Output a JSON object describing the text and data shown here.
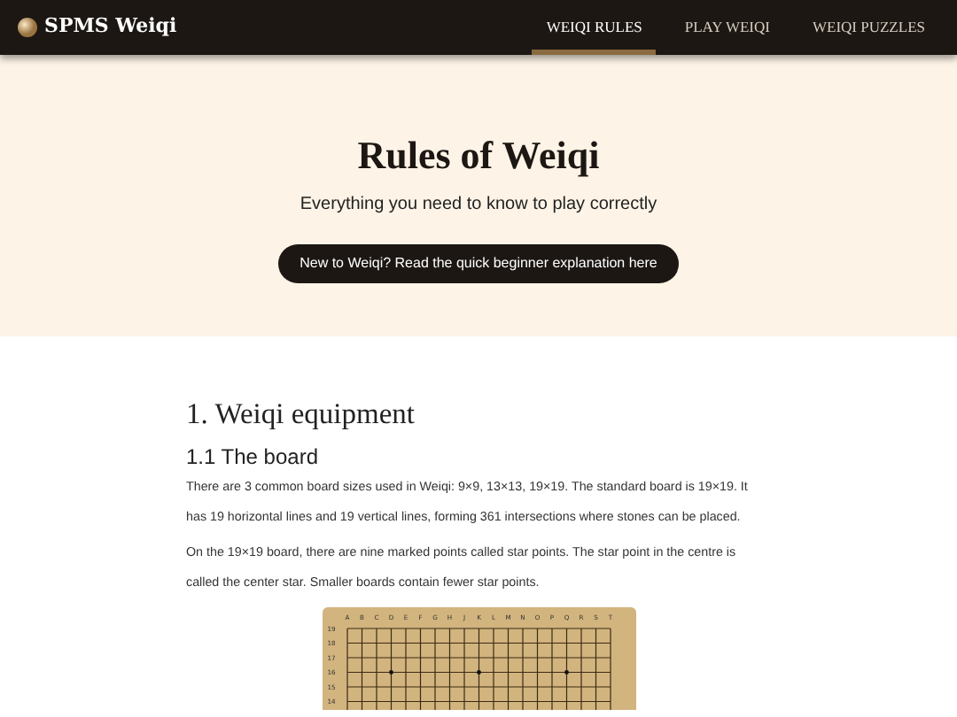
{
  "navbar": {
    "brand": "SPMS Weiqi",
    "links": [
      {
        "label": "WEIQI RULES",
        "selected": true
      },
      {
        "label": "PLAY WEIQI",
        "selected": false
      },
      {
        "label": "WEIQI PUZZLES",
        "selected": false
      }
    ]
  },
  "hero": {
    "title": "Rules of Weiqi",
    "subtitle": "Everything you need to know to play correctly",
    "button": "New to Weiqi? Read the quick beginner explanation here"
  },
  "section": {
    "heading": "1. Weiqi equipment",
    "subheading": "1.1 The board",
    "paragraphs": [
      "There are 3 common board sizes used in Weiqi: 9×9, 13×13, 19×19. The standard board is 19×19. It has 19 horizontal lines and 19 vertical lines, forming 361 intersections where stones can be placed.",
      "On the 19×19 board, there are nine marked points called star points. The star point in the centre is called the center star. Smaller boards contain fewer star points."
    ]
  },
  "board": {
    "column_labels": [
      "A",
      "B",
      "C",
      "D",
      "E",
      "F",
      "G",
      "H",
      "J",
      "K",
      "L",
      "M",
      "N",
      "O",
      "P",
      "Q",
      "R",
      "S",
      "T"
    ],
    "row_labels": [
      "19",
      "18",
      "17",
      "16",
      "15",
      "14"
    ]
  }
}
